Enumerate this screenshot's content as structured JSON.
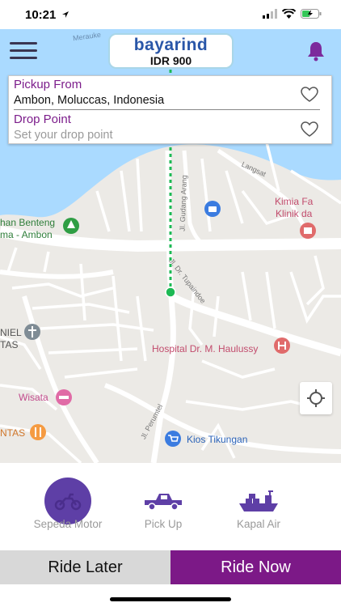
{
  "status_bar": {
    "time": "10:21"
  },
  "header": {
    "logo_text": "bayarind",
    "balance": "IDR 900"
  },
  "route": {
    "pickup_title": "Pickup From",
    "pickup_value": "Ambon, Moluccas, Indonesia",
    "drop_title": "Drop Point",
    "drop_placeholder": "Set your drop point"
  },
  "map": {
    "places": {
      "kimia_line1": "Kimia Fa",
      "kimia_line2": "Klinik da",
      "benteng_line1": "han Benteng",
      "benteng_line2": "ma - Ambon",
      "hospital": "Hospital Dr. M. Haulussy",
      "niel_line1": "NIEL",
      "niel_line2": "TAS",
      "wisata": "Wisata",
      "ntas": "NTAS",
      "kios": "Kios Tikungan"
    },
    "streets": {
      "merauke": "Merauke",
      "langsat": "Langsat",
      "gudang_arang": "Jl. Gudang Arang",
      "dr_tupaindoe": "Jl. Dr. Tupaindoe",
      "perumtel": "Jl. Perumtel",
      "rumtel": "Perumtel"
    }
  },
  "vehicles": [
    {
      "label": "Sepeda Motor",
      "icon": "motorbike-icon",
      "selected": true
    },
    {
      "label": "Pick Up",
      "icon": "pickup-truck-icon",
      "selected": false
    },
    {
      "label": "Kapal Air",
      "icon": "ship-icon",
      "selected": false
    }
  ],
  "actions": {
    "ride_later": "Ride Later",
    "ride_now": "Ride Now"
  },
  "colors": {
    "accent": "#7c1987",
    "route_title": "#7c1d8b",
    "selected_vehicle": "#5e3fa6",
    "water": "#aadaff",
    "route_line": "#1db954"
  }
}
